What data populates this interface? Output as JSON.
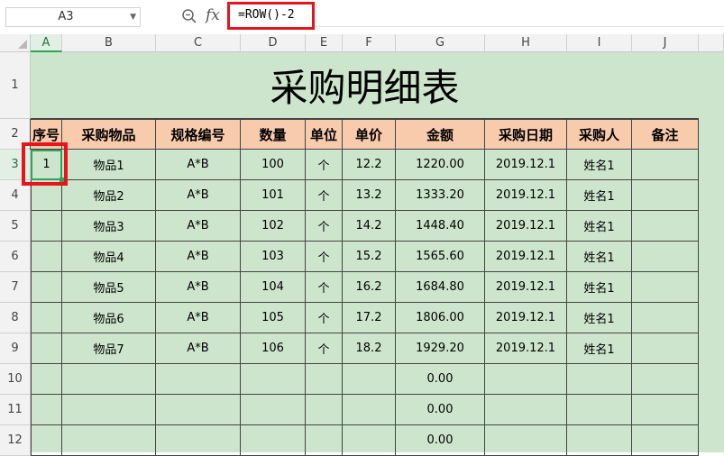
{
  "formula_bar": {
    "name_box": "A3",
    "fx_label": "fx",
    "formula": "=ROW()-2",
    "zoom_icon": "zoom-icon"
  },
  "columns": [
    "A",
    "B",
    "C",
    "D",
    "E",
    "F",
    "G",
    "H",
    "I",
    "J"
  ],
  "rows": [
    "1",
    "2",
    "3",
    "4",
    "5",
    "6",
    "7",
    "8",
    "9",
    "10",
    "11",
    "12"
  ],
  "sheet": {
    "title": "采购明细表",
    "headers": [
      "序号",
      "采购物品",
      "规格编号",
      "数量",
      "单位",
      "单价",
      "金额",
      "采购日期",
      "采购人",
      "备注"
    ],
    "data": [
      [
        "1",
        "物品1",
        "A*B",
        "100",
        "个",
        "12.2",
        "1220.00",
        "2019.12.1",
        "姓名1",
        ""
      ],
      [
        "",
        "物品2",
        "A*B",
        "101",
        "个",
        "13.2",
        "1333.20",
        "2019.12.1",
        "姓名1",
        ""
      ],
      [
        "",
        "物品3",
        "A*B",
        "102",
        "个",
        "14.2",
        "1448.40",
        "2019.12.1",
        "姓名1",
        ""
      ],
      [
        "",
        "物品4",
        "A*B",
        "103",
        "个",
        "15.2",
        "1565.60",
        "2019.12.1",
        "姓名1",
        ""
      ],
      [
        "",
        "物品5",
        "A*B",
        "104",
        "个",
        "16.2",
        "1684.80",
        "2019.12.1",
        "姓名1",
        ""
      ],
      [
        "",
        "物品6",
        "A*B",
        "105",
        "个",
        "17.2",
        "1806.00",
        "2019.12.1",
        "姓名1",
        ""
      ],
      [
        "",
        "物品7",
        "A*B",
        "106",
        "个",
        "18.2",
        "1929.20",
        "2019.12.1",
        "姓名1",
        ""
      ],
      [
        "",
        "",
        "",
        "",
        "",
        "",
        "0.00",
        "",
        "",
        ""
      ],
      [
        "",
        "",
        "",
        "",
        "",
        "",
        "0.00",
        "",
        "",
        ""
      ],
      [
        "",
        "",
        "",
        "",
        "",
        "",
        "0.00",
        "",
        "",
        ""
      ]
    ]
  },
  "colors": {
    "header_fill": "#f8cbad",
    "sheet_fill": "#cce5cc",
    "highlight": "#e8141c",
    "selection": "#2ea35a"
  }
}
